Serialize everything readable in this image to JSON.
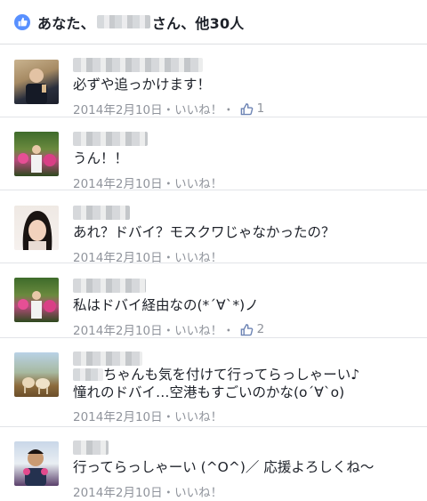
{
  "likes": {
    "prefix": "あなた、",
    "suffix": "さん、他30人"
  },
  "comments": [
    {
      "text": "必ずや追っかけます！",
      "date": "2014年2月10日",
      "sep1": "・",
      "like_label": "いいね！",
      "sep2": "・",
      "like_count": "1"
    },
    {
      "text": "うん！！",
      "date": "2014年2月10日",
      "sep1": "・",
      "like_label": "いいね！"
    },
    {
      "text": "あれ？ドバイ？モスクワじゃなかったの？",
      "date": "2014年2月10日",
      "sep1": "・",
      "like_label": "いいね！"
    },
    {
      "text": "私はドバイ経由なの(*´∀`*)ノ",
      "date": "2014年2月10日",
      "sep1": "・",
      "like_label": "いいね！",
      "sep2": "・",
      "like_count": "2"
    },
    {
      "text_line1": "ちゃんも気を付けて行ってらっしゃーい♪",
      "text_line2": "憧れのドバイ…空港もすごいのかな(o´∀`o)",
      "date": "2014年2月10日",
      "sep1": "・",
      "like_label": "いいね！"
    },
    {
      "text": "行ってらっしゃーい (^O^)／ 応援よろしくね〜",
      "date": "2014年2月10日",
      "sep1": "・",
      "like_label": "いいね！"
    }
  ],
  "colors": {
    "facebook_blue": "#5890ff",
    "meta_gray": "#90949c",
    "text": "#1d2129"
  },
  "icons": {
    "likes_badge": "thumbs-up-icon",
    "like_count": "thumbs-up-outline-icon"
  }
}
